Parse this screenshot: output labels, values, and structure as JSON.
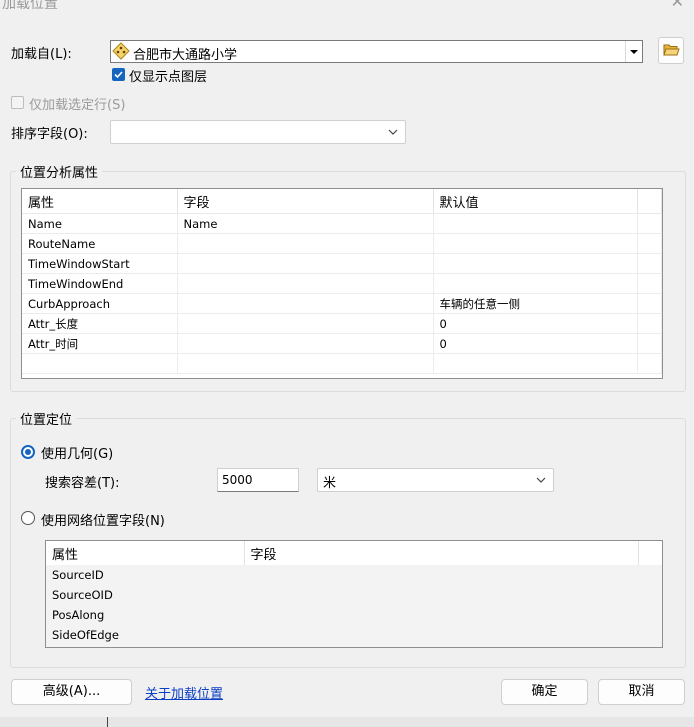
{
  "window": {
    "title": "加载位置"
  },
  "load_from": {
    "label": "加载自(L):",
    "value": "合肥市大通路小学",
    "show_point_layers_label": "仅显示点图层"
  },
  "load_selected_label": "仅加载选定行(S)",
  "sort_field": {
    "label": "排序字段(O):",
    "value": ""
  },
  "location_analysis": {
    "title": "位置分析属性",
    "columns": [
      "属性",
      "字段",
      "默认值"
    ],
    "rows": [
      {
        "property": "Name",
        "field": "Name",
        "default": ""
      },
      {
        "property": "RouteName",
        "field": "",
        "default": ""
      },
      {
        "property": "TimeWindowStart",
        "field": "",
        "default": ""
      },
      {
        "property": "TimeWindowEnd",
        "field": "",
        "default": ""
      },
      {
        "property": "CurbApproach",
        "field": "",
        "default": "车辆的任意一侧"
      },
      {
        "property": "Attr_长度",
        "field": "",
        "default": "0"
      },
      {
        "property": "Attr_时间",
        "field": "",
        "default": "0"
      }
    ]
  },
  "positioning": {
    "title": "位置定位",
    "use_geometry_label": "使用几何(G)",
    "tolerance_label": "搜索容差(T):",
    "tolerance_value": "5000",
    "unit_value": "米",
    "use_network_label": "使用网络位置字段(N)",
    "network_columns": [
      "属性",
      "字段"
    ],
    "network_rows": [
      {
        "property": "SourceID",
        "field": ""
      },
      {
        "property": "SourceOID",
        "field": ""
      },
      {
        "property": "PosAlong",
        "field": ""
      },
      {
        "property": "SideOfEdge",
        "field": ""
      }
    ]
  },
  "buttons": {
    "advanced": "高级(A)...",
    "about_link": "关于加载位置",
    "ok": "确定",
    "cancel": "取消"
  },
  "states": {
    "show_point_layers_checked": true,
    "load_selected_checked": false,
    "use_geometry_selected": true
  }
}
